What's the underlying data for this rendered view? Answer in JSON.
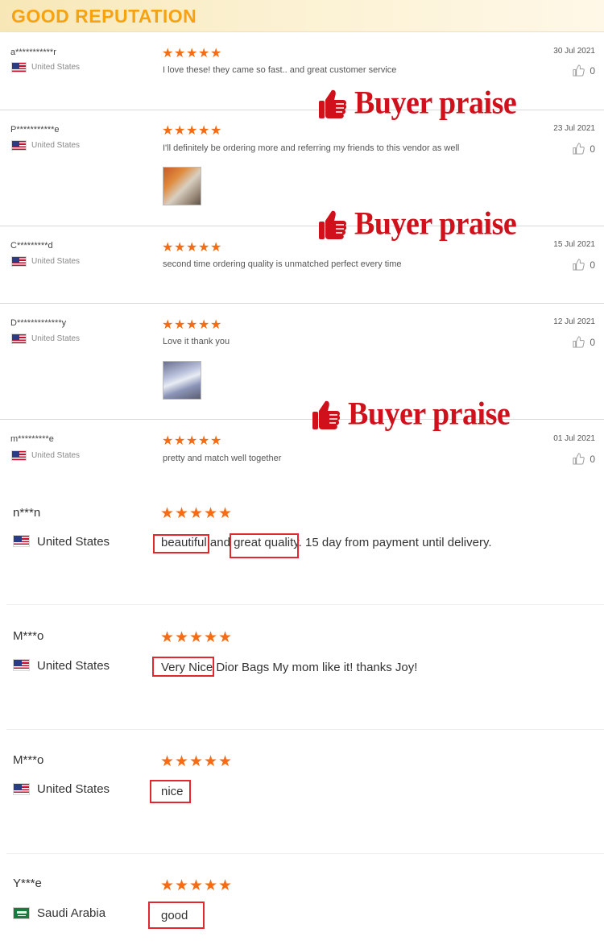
{
  "header": {
    "title": "GOOD REPUTATION"
  },
  "badge_text": "Buyer praise",
  "star_glyph": "★",
  "star_color": "#f56c14",
  "small_reviews": [
    {
      "name": "a***********r",
      "country": "United States",
      "text": "I love these! they came so fast.. and great customer service",
      "date": "30 Jul 2021",
      "likes": "0",
      "rating": 5,
      "flag": "us-flag"
    },
    {
      "name": "P***********e",
      "country": "United States",
      "text": "I'll definitely be ordering more and referring my friends to this vendor as well",
      "date": "23 Jul 2021",
      "likes": "0",
      "rating": 5,
      "flag": "us-flag"
    },
    {
      "name": "C*********d",
      "country": "United States",
      "text": "second time ordering quality is unmatched perfect every time",
      "date": "15 Jul 2021",
      "likes": "0",
      "rating": 5,
      "flag": "us-flag"
    },
    {
      "name": "D*************y",
      "country": "United States",
      "text": "Love it thank you",
      "date": "12 Jul 2021",
      "likes": "0",
      "rating": 5,
      "flag": "us-flag"
    },
    {
      "name": "m*********e",
      "country": "United States",
      "text": "pretty and match well together",
      "date": "01 Jul 2021",
      "likes": "0",
      "rating": 5,
      "flag": "us-flag"
    }
  ],
  "big_reviews": [
    {
      "name": "n***n",
      "country": "United States",
      "text": "beautiful and great quality. 15 day from payment until delivery.",
      "rating": 5,
      "flag": "us-flag"
    },
    {
      "name": "M***o",
      "country": "United States",
      "text": "Very Nice Dior Bags My mom like it! thanks Joy!",
      "rating": 5,
      "flag": "us-flag"
    },
    {
      "name": "M***o",
      "country": "United States",
      "text": "nice",
      "rating": 5,
      "flag": "us-flag"
    },
    {
      "name": "Y***e",
      "country": "Saudi Arabia",
      "text": "good",
      "rating": 5,
      "flag": "sa-flag"
    }
  ]
}
